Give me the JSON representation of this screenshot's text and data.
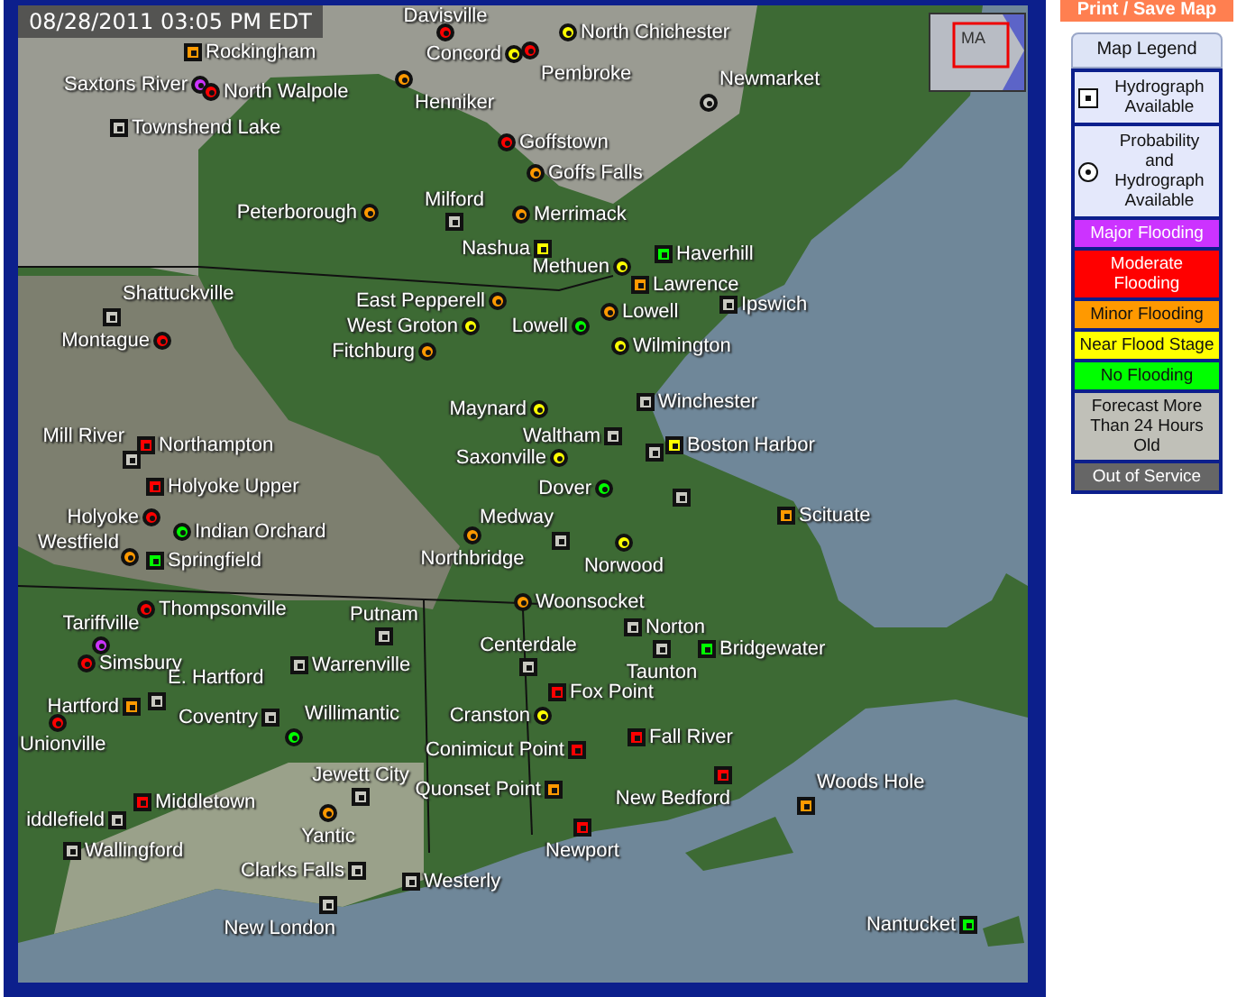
{
  "print_button": "Print / Save Map",
  "map": {
    "timestamp": "08/28/2011 03:05 PM EDT",
    "inset_label": "MA",
    "gauges": [
      {
        "name": "Davisville",
        "kind": "probability",
        "color": "#ff0000"
      },
      {
        "name": "North Chichester",
        "kind": "probability",
        "color": "#ffff00"
      },
      {
        "name": "Rockingham",
        "kind": "hydrograph",
        "color": "#ff9900"
      },
      {
        "name": "Concord",
        "kind": "probability",
        "color": "#ffff00"
      },
      {
        "name": "Saxtons River",
        "kind": "probability",
        "color": "#cc33ff"
      },
      {
        "name": "North Walpole",
        "kind": "probability",
        "color": "#ff0000"
      },
      {
        "name": "Pembroke",
        "kind": "probability",
        "color": "#ff0000"
      },
      {
        "name": "Newmarket",
        "kind": "probability",
        "color": "#c8c8c0"
      },
      {
        "name": "Henniker",
        "kind": "probability",
        "color": "#ff9900"
      },
      {
        "name": "Townshend Lake",
        "kind": "hydrograph",
        "color": "#c8c8c0"
      },
      {
        "name": "Goffstown",
        "kind": "probability",
        "color": "#ff0000"
      },
      {
        "name": "Goffs Falls",
        "kind": "probability",
        "color": "#ff9900"
      },
      {
        "name": "Peterborough",
        "kind": "probability",
        "color": "#ff9900"
      },
      {
        "name": "Milford",
        "kind": "hydrograph",
        "color": "#c8c8c0"
      },
      {
        "name": "Merrimack",
        "kind": "probability",
        "color": "#ff9900"
      },
      {
        "name": "Nashua",
        "kind": "hydrograph",
        "color": "#ffff00"
      },
      {
        "name": "Haverhill",
        "kind": "hydrograph",
        "color": "#00ff00"
      },
      {
        "name": "Methuen",
        "kind": "probability",
        "color": "#ffff00"
      },
      {
        "name": "Lawrence",
        "kind": "hydrograph",
        "color": "#ff9900"
      },
      {
        "name": "Shattuckville",
        "kind": "hydrograph",
        "color": "#c8c8c0"
      },
      {
        "name": "East Pepperell",
        "kind": "probability",
        "color": "#ff9900"
      },
      {
        "name": "Lowell",
        "kind": "probability",
        "color": "#ff9900"
      },
      {
        "name": "Ipswich",
        "kind": "hydrograph",
        "color": "#c8c8c0"
      },
      {
        "name": "West Groton",
        "kind": "probability",
        "color": "#ffff00"
      },
      {
        "name": "Lowell",
        "kind": "probability",
        "color": "#00ff00"
      },
      {
        "name": "Montague",
        "kind": "probability",
        "color": "#ff0000"
      },
      {
        "name": "Fitchburg",
        "kind": "probability",
        "color": "#ff9900"
      },
      {
        "name": "Wilmington",
        "kind": "probability",
        "color": "#ffff00"
      },
      {
        "name": "Maynard",
        "kind": "probability",
        "color": "#ffff00"
      },
      {
        "name": "Winchester",
        "kind": "hydrograph",
        "color": "#c8c8c0"
      },
      {
        "name": "Mill River",
        "kind": "hydrograph",
        "color": "#c8c8c0"
      },
      {
        "name": "Northampton",
        "kind": "hydrograph",
        "color": "#ff0000"
      },
      {
        "name": "Waltham",
        "kind": "hydrograph",
        "color": "#c8c8c0"
      },
      {
        "kind": "hydrograph",
        "color": "#c8c8c0"
      },
      {
        "name": "Boston Harbor",
        "kind": "hydrograph",
        "color": "#ffff00"
      },
      {
        "name": "Saxonville",
        "kind": "probability",
        "color": "#ffff00"
      },
      {
        "name": "Holyoke Upper",
        "kind": "hydrograph",
        "color": "#ff0000"
      },
      {
        "name": "Dover",
        "kind": "probability",
        "color": "#00ff00"
      },
      {
        "kind": "hydrograph",
        "color": "#c8c8c0"
      },
      {
        "name": "Holyoke",
        "kind": "probability",
        "color": "#ff0000"
      },
      {
        "name": "Indian Orchard",
        "kind": "probability",
        "color": "#00ff00"
      },
      {
        "name": "Medway",
        "kind": "hydrograph",
        "color": "#c8c8c0"
      },
      {
        "name": "Scituate",
        "kind": "hydrograph",
        "color": "#ff9900"
      },
      {
        "name": "Westfield",
        "kind": "probability",
        "color": "#ff9900"
      },
      {
        "name": "Springfield",
        "kind": "hydrograph",
        "color": "#00ff00"
      },
      {
        "name": "Northbridge",
        "kind": "probability",
        "color": "#ff9900"
      },
      {
        "name": "Norwood",
        "kind": "probability",
        "color": "#ffff00"
      },
      {
        "name": "Thompsonville",
        "kind": "probability",
        "color": "#ff0000"
      },
      {
        "name": "Putnam",
        "kind": "hydrograph",
        "color": "#c8c8c0"
      },
      {
        "name": "Woonsocket",
        "kind": "probability",
        "color": "#ff9900"
      },
      {
        "name": "Tariffville",
        "kind": "probability",
        "color": "#cc33ff"
      },
      {
        "name": "Norton",
        "kind": "hydrograph",
        "color": "#c8c8c0"
      },
      {
        "name": "Simsbury",
        "kind": "probability",
        "color": "#ff0000"
      },
      {
        "name": "Warrenville",
        "kind": "hydrograph",
        "color": "#c8c8c0"
      },
      {
        "name": "Centerdale",
        "kind": "hydrograph",
        "color": "#c8c8c0"
      },
      {
        "name": "Taunton",
        "kind": "hydrograph",
        "color": "#c8c8c0"
      },
      {
        "name": "Bridgewater",
        "kind": "hydrograph",
        "color": "#00ff00"
      },
      {
        "name": "E. Hartford",
        "kind": "hydrograph",
        "color": "#c8c8c0"
      },
      {
        "name": "Fox Point",
        "kind": "hydrograph",
        "color": "#ff0000"
      },
      {
        "name": "Hartford",
        "kind": "hydrograph",
        "color": "#ff9900"
      },
      {
        "name": "Coventry",
        "kind": "hydrograph",
        "color": "#c8c8c0"
      },
      {
        "name": "Willimantic",
        "kind": "probability",
        "color": "#00ff00"
      },
      {
        "name": "Cranston",
        "kind": "probability",
        "color": "#ffff00"
      },
      {
        "name": "Fall River",
        "kind": "hydrograph",
        "color": "#ff0000"
      },
      {
        "name": "Unionville",
        "kind": "probability",
        "color": "#ff0000"
      },
      {
        "name": "Conimicut Point",
        "kind": "hydrograph",
        "color": "#ff0000"
      },
      {
        "name": "Jewett City",
        "kind": "hydrograph",
        "color": "#c8c8c0"
      },
      {
        "name": "Middletown",
        "kind": "hydrograph",
        "color": "#ff0000"
      },
      {
        "name": "Quonset Point",
        "kind": "hydrograph",
        "color": "#ff9900"
      },
      {
        "name": "New Bedford",
        "kind": "hydrograph",
        "color": "#ff0000"
      },
      {
        "name": "Woods Hole",
        "kind": "hydrograph",
        "color": "#ff9900"
      },
      {
        "name": "iddlefield",
        "kind": "hydrograph",
        "color": "#c8c8c0"
      },
      {
        "name": "Yantic",
        "kind": "probability",
        "color": "#ff9900"
      },
      {
        "name": "Wallingford",
        "kind": "hydrograph",
        "color": "#c8c8c0"
      },
      {
        "name": "Newport",
        "kind": "hydrograph",
        "color": "#ff0000"
      },
      {
        "name": "Clarks Falls",
        "kind": "hydrograph",
        "color": "#c8c8c0"
      },
      {
        "name": "Westerly",
        "kind": "hydrograph",
        "color": "#c8c8c0"
      },
      {
        "name": "New London",
        "kind": "hydrograph",
        "color": "#c8c8c0"
      },
      {
        "name": "Nantucket",
        "kind": "hydrograph",
        "color": "#00ff00"
      }
    ]
  },
  "legend": {
    "title": "Map Legend",
    "items": [
      {
        "kind": "square-symbol",
        "label": "Hydrograph Available"
      },
      {
        "kind": "circle-symbol",
        "label": "Probability and Hydrograph Available"
      },
      {
        "kind": "swatch",
        "label": "Major Flooding",
        "color": "#cc33ff"
      },
      {
        "kind": "swatch",
        "label": "Moderate Flooding",
        "color": "#ff0000"
      },
      {
        "kind": "swatch",
        "label": "Minor Flooding",
        "color": "#ff9900"
      },
      {
        "kind": "swatch",
        "label": "Near Flood Stage",
        "color": "#ffff00"
      },
      {
        "kind": "swatch",
        "label": "No Flooding",
        "color": "#00ff00"
      },
      {
        "kind": "swatch",
        "label": "Forecast More Than 24 Hours Old",
        "color": "#c0c0b8"
      },
      {
        "kind": "swatch",
        "label": "Out of Service",
        "color": "#666666"
      }
    ]
  }
}
